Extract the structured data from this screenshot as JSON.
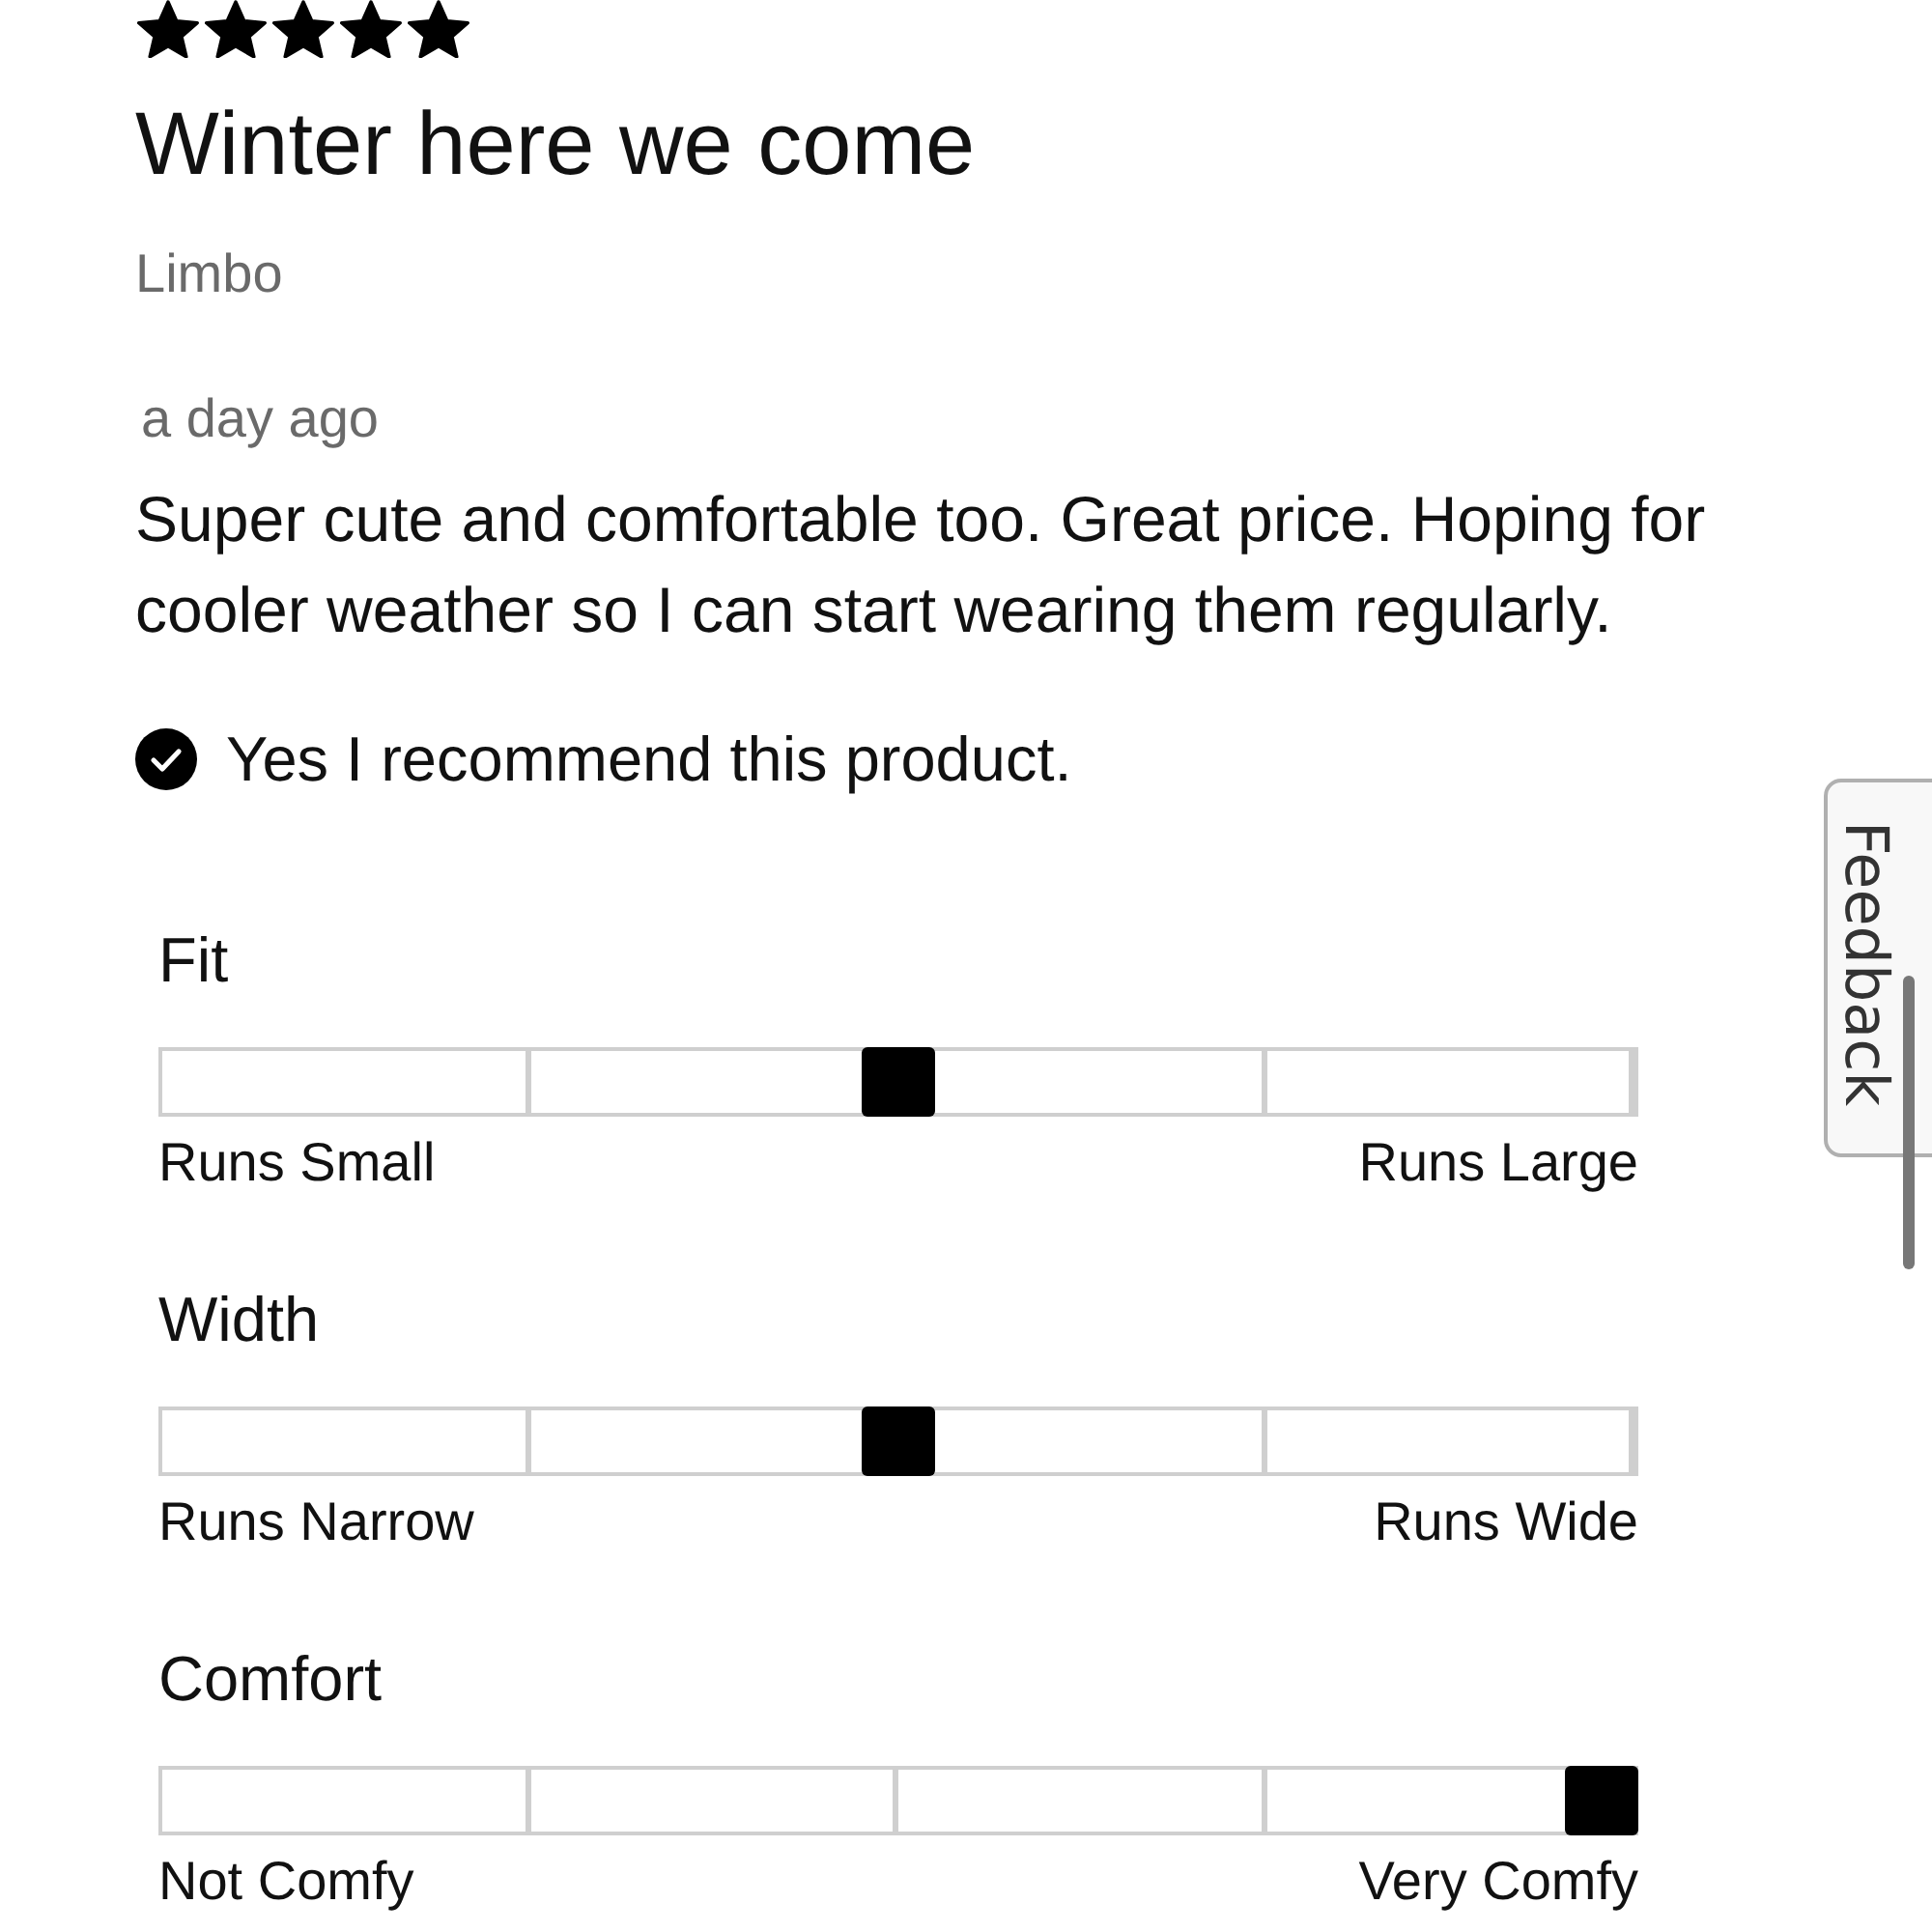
{
  "review": {
    "stars": 5,
    "title": "Winter here we come",
    "author": "Limbo",
    "date": "a day ago",
    "body": "Super cute and comfortable too. Great price. Hoping for cooler weather so I can start wearing them regularly.",
    "recommendation": {
      "checked": true,
      "text": "Yes I recommend this product."
    }
  },
  "scales": [
    {
      "label": "Fit",
      "level": 0.5,
      "min_label": "Runs Small",
      "max_label": "Runs Large"
    },
    {
      "label": "Width",
      "level": 0.5,
      "min_label": "Runs Narrow",
      "max_label": "Runs Wide"
    },
    {
      "label": "Comfort",
      "level": 1.0,
      "min_label": "Not Comfy",
      "max_label": "Very Comfy"
    }
  ],
  "feedback_tab": {
    "label": "Feedback"
  }
}
